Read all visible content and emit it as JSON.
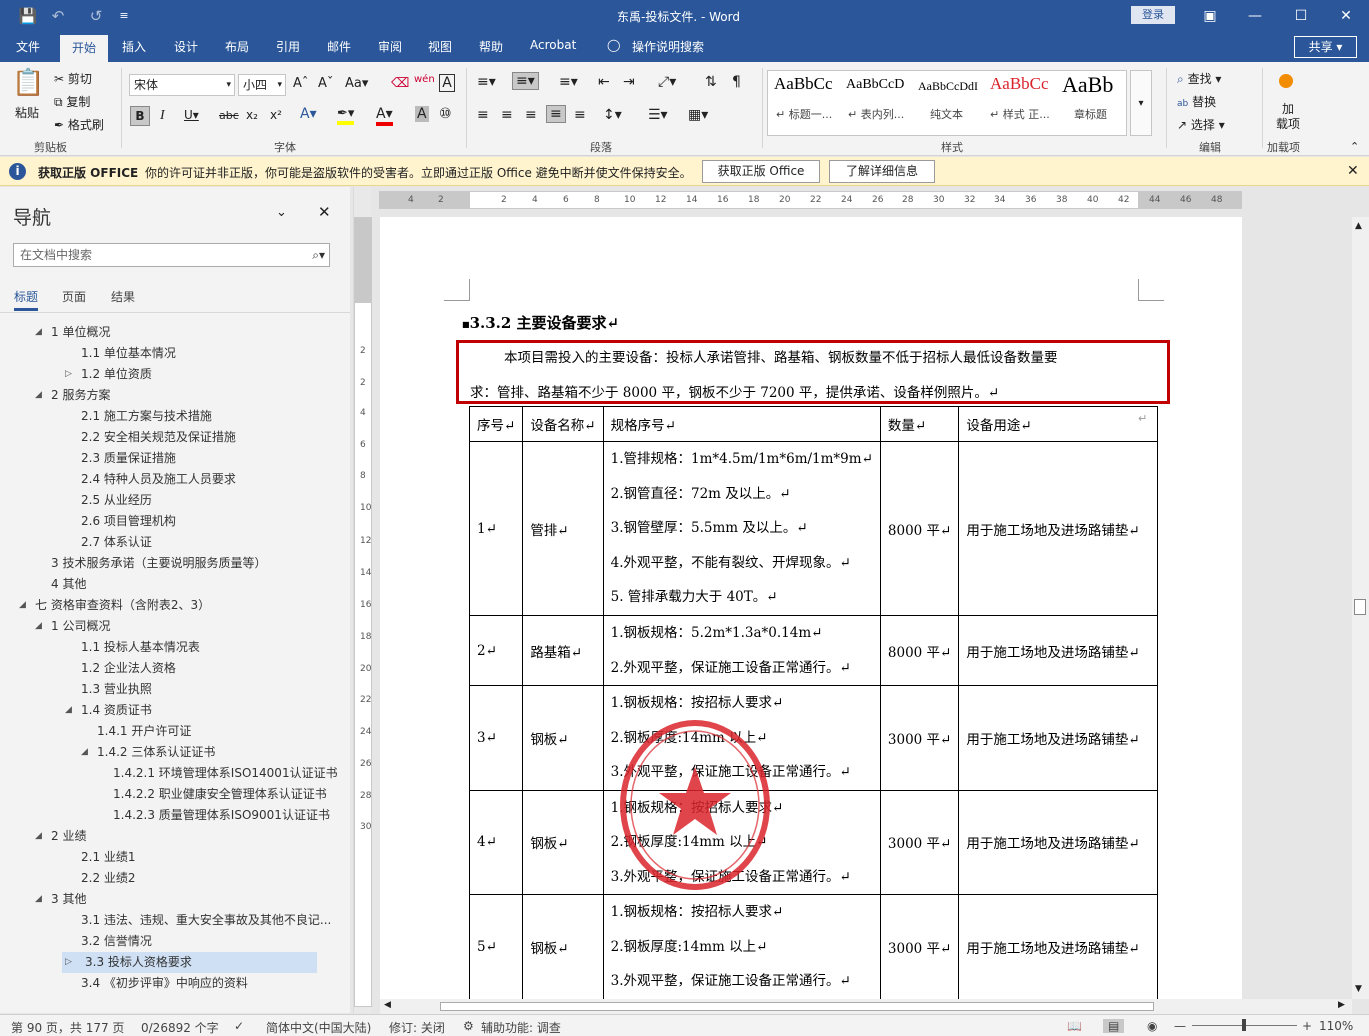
{
  "window": {
    "title": "东禹-投标文件. - Word",
    "login": "登录"
  },
  "tabs": [
    "文件",
    "开始",
    "插入",
    "设计",
    "布局",
    "引用",
    "邮件",
    "审阅",
    "视图",
    "帮助",
    "Acrobat",
    "操作说明搜索"
  ],
  "share": "共享",
  "ribbon": {
    "clipboard": {
      "paste": "粘贴",
      "cut": "剪切",
      "copy": "复制",
      "format_painter": "格式刷",
      "label": "剪贴板"
    },
    "font": {
      "name": "宋体",
      "size": "小四",
      "label": "字体"
    },
    "paragraph": {
      "label": "段落"
    },
    "styles": {
      "label": "样式",
      "items": [
        {
          "preview": "AaBbCc",
          "name": "↵ 标题一..."
        },
        {
          "preview": "AaBbCcD",
          "name": "↵ 表内列..."
        },
        {
          "preview": "AaBbCcDdI",
          "name": "纯文本"
        },
        {
          "preview": "AaBbCc",
          "name": "↵ 样式 正..."
        },
        {
          "preview": "AaBb",
          "name": "章标题"
        }
      ]
    },
    "editing": {
      "find": "查找",
      "replace": "替换",
      "select": "选择",
      "label": "编辑"
    },
    "addins": {
      "load": "加\n载项",
      "label": "加载项"
    }
  },
  "warning": {
    "title": "获取正版 OFFICE",
    "text": "你的许可证并非正版，你可能是盗版软件的受害者。立即通过正版 Office 避免中断并使文件保持安全。",
    "btn1": "获取正版 Office",
    "btn2": "了解详细信息"
  },
  "nav": {
    "title": "导航",
    "search_placeholder": "在文档中搜索",
    "tabs": [
      "标题",
      "页面",
      "结果"
    ],
    "items": [
      {
        "text": "1 单位概况",
        "level": 1,
        "tri": "open"
      },
      {
        "text": "1.1 单位基本情况",
        "level": 2,
        "tri": ""
      },
      {
        "text": "1.2 单位资质",
        "level": 2,
        "tri": "closed"
      },
      {
        "text": "2 服务方案",
        "level": 1,
        "tri": "open"
      },
      {
        "text": "2.1 施工方案与技术措施",
        "level": 2,
        "tri": ""
      },
      {
        "text": "2.2 安全相关规范及保证措施",
        "level": 2,
        "tri": ""
      },
      {
        "text": "2.3 质量保证措施",
        "level": 2,
        "tri": ""
      },
      {
        "text": "2.4 特种人员及施工人员要求",
        "level": 2,
        "tri": ""
      },
      {
        "text": "2.5 从业经历",
        "level": 2,
        "tri": ""
      },
      {
        "text": "2.6 项目管理机构",
        "level": 2,
        "tri": ""
      },
      {
        "text": "2.7 体系认证",
        "level": 2,
        "tri": ""
      },
      {
        "text": "3 技术服务承诺（主要说明服务质量等）",
        "level": 1,
        "tri": ""
      },
      {
        "text": "4 其他",
        "level": 1,
        "tri": ""
      },
      {
        "text": "七 资格审查资料（含附表2、3）",
        "level": 0,
        "tri": "open"
      },
      {
        "text": "1 公司概况",
        "level": 1,
        "tri": "open"
      },
      {
        "text": "1.1 投标人基本情况表",
        "level": 2,
        "tri": ""
      },
      {
        "text": "1.2 企业法人资格",
        "level": 2,
        "tri": ""
      },
      {
        "text": "1.3 营业执照",
        "level": 2,
        "tri": ""
      },
      {
        "text": "1.4 资质证书",
        "level": 2,
        "tri": "open"
      },
      {
        "text": "1.4.1 开户许可证",
        "level": 3,
        "tri": ""
      },
      {
        "text": "1.4.2 三体系认证证书",
        "level": 3,
        "tri": "open"
      },
      {
        "text": "1.4.2.1 环境管理体系ISO14001认证证书",
        "level": 4,
        "tri": ""
      },
      {
        "text": "1.4.2.2 职业健康安全管理体系认证证书",
        "level": 4,
        "tri": ""
      },
      {
        "text": "1.4.2.3 质量管理体系ISO9001认证证书",
        "level": 4,
        "tri": ""
      },
      {
        "text": "2 业绩",
        "level": 1,
        "tri": "open"
      },
      {
        "text": "2.1 业绩1",
        "level": 2,
        "tri": ""
      },
      {
        "text": "2.2 业绩2",
        "level": 2,
        "tri": ""
      },
      {
        "text": "3 其他",
        "level": 1,
        "tri": "open"
      },
      {
        "text": "3.1 违法、违规、重大安全事故及其他不良记...",
        "level": 2,
        "tri": ""
      },
      {
        "text": "3.2 信誉情况",
        "level": 2,
        "tri": ""
      },
      {
        "text": "3.3 投标人资格要求",
        "level": 2,
        "tri": "closed",
        "selected": true
      },
      {
        "text": "3.4 《初步评审》中响应的资料",
        "level": 2,
        "tri": ""
      }
    ]
  },
  "ruler": {
    "h": [
      "4",
      "2",
      "2",
      "4",
      "6",
      "8",
      "10",
      "12",
      "14",
      "16",
      "18",
      "20",
      "22",
      "24",
      "26",
      "28",
      "30",
      "32",
      "34",
      "36",
      "38",
      "40",
      "42",
      "44",
      "46",
      "48"
    ],
    "v": [
      "2",
      "2",
      "4",
      "6",
      "8",
      "10",
      "12",
      "14",
      "16",
      "18",
      "20",
      "22",
      "24",
      "26",
      "28",
      "30"
    ]
  },
  "doc": {
    "heading": "3.3.2   主要设备要求↵",
    "para_line1": "本项目需投入的主要设备：投标人承诺管排、路基箱、钢板数量不低于招标人最低设备数量要",
    "para_line2": "求：管排、路基箱不少于 8000 平，钢板不少于 7200 平，提供承诺、设备样例照片。↵",
    "headers": [
      "序号↵",
      "设备名称↵",
      "规格序号↵",
      "数量↵",
      "设备用途↵"
    ],
    "rows": [
      {
        "no": "1↵",
        "name": "管排↵",
        "specs": [
          "1.管排规格：1m*4.5m/1m*6m/1m*9m↵",
          "2.钢管直径：72m 及以上。↵",
          "3.钢管壁厚：5.5mm 及以上。↵",
          "4.外观平整，不能有裂纹、开焊现象。↵",
          "5.  管排承载力大于  40T。↵"
        ],
        "qty": "8000 平↵",
        "use": "用于施工场地及进场路铺垫↵"
      },
      {
        "no": "2↵",
        "name": "路基箱↵",
        "specs": [
          "1.钢板规格：5.2m*1.3a*0.14m↵",
          "2.外观平整，保证施工设备正常通行。↵"
        ],
        "qty": "8000 平↵",
        "use": "用于施工场地及进场路铺垫↵"
      },
      {
        "no": "3↵",
        "name": "钢板↵",
        "specs": [
          "1.钢板规格：按招标人要求↵",
          "2.钢板厚度:14mm 以上↵",
          "3.外观平整，保证施工设备正常通行。↵"
        ],
        "qty": "3000 平↵",
        "use": "用于施工场地及进场路铺垫↵"
      },
      {
        "no": "4↵",
        "name": "钢板↵",
        "specs": [
          "1.钢板规格：按招标人要求↵",
          "2.钢板厚度:14mm 以上↵",
          "3.外观平整，保证施工设备正常通行。↵"
        ],
        "qty": "3000 平↵",
        "use": "用于施工场地及进场路铺垫↵"
      },
      {
        "no": "5↵",
        "name": "钢板↵",
        "specs": [
          "1.钢板规格：按招标人要求↵",
          "2.钢板厚度:14mm 以上↵",
          "3.外观平整，保证施工设备正常通行。↵"
        ],
        "qty": "3000 平↵",
        "use": "用于施工场地及进场路铺垫↵"
      }
    ],
    "stamp_color": "#d9242b",
    "highlight_color": "#c00000"
  },
  "status": {
    "page": "第 90 页，共 177 页",
    "words": "0/26892 个字",
    "lang": "简体中文(中国大陆)",
    "track": "修订: 关闭",
    "access": "辅助功能: 调查",
    "zoom": "110%"
  }
}
